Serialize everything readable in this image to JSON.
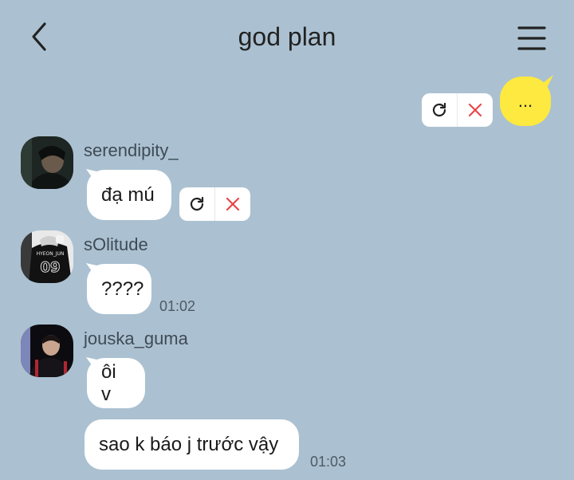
{
  "header": {
    "title": "god plan",
    "back_icon": "chevron-left-icon",
    "menu_icon": "hamburger-menu-icon"
  },
  "outgoing": {
    "text": "...",
    "bubble_color": "#fde93f",
    "actions": [
      "retry-icon",
      "delete-icon"
    ]
  },
  "messages": [
    {
      "sender": "serendipity_",
      "text": "đạ mú",
      "time": "",
      "failed": true
    },
    {
      "sender": "sOlitude",
      "text": "????",
      "time": "01:02"
    },
    {
      "sender": "jouska_guma",
      "text": "ôi v",
      "time": ""
    },
    {
      "sender": "jouska_guma",
      "text": "sao k báo j trước vậy",
      "time": "01:03"
    }
  ],
  "avatars": {
    "serendipity_": "avatar-photo",
    "sOlitude": "avatar-jersey-photo",
    "jouska_guma": "avatar-photo"
  },
  "jersey_text": {
    "name": "HYEON_JUN",
    "number": "09"
  },
  "colors": {
    "background": "#abc1d1",
    "bubble": "#ffffff",
    "delete_x": "#e8474a"
  }
}
